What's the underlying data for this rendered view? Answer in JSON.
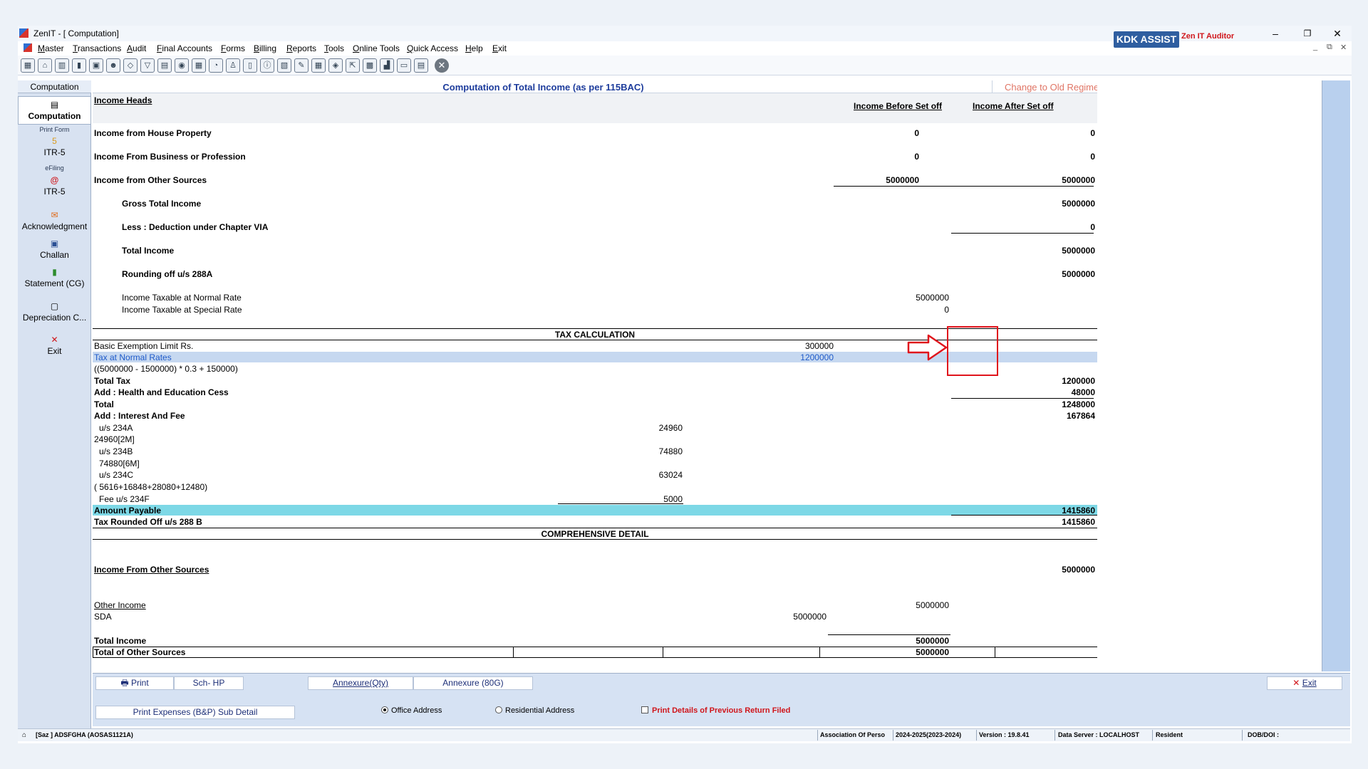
{
  "window": {
    "title": "ZenIT - [ Computation]",
    "controls": {
      "minimize": "–",
      "restore": "❐",
      "close": "✕"
    },
    "mdi_controls": {
      "minimize": "_",
      "restore": "⧉",
      "close": "✕"
    }
  },
  "menu": [
    "Master",
    "Transactions",
    "Audit",
    "Final Accounts",
    "Forms",
    "Billing",
    "Reports",
    "Tools",
    "Online Tools",
    "Quick Access",
    "Help",
    "Exit"
  ],
  "toolbar": {
    "kdk_assist": "KDK ASSIST",
    "zen_it_auditor": "Zen IT Auditor"
  },
  "sidebar": {
    "header": "Computation",
    "computation": "Computation",
    "print_form_caption": "Print Form",
    "itr5_print": "ITR-5",
    "efiling_caption": "eFiling",
    "itr5_efile": "ITR-5",
    "acknowledgment": "Acknowledgment",
    "challan": "Challan",
    "statement_cg": "Statement (CG)",
    "depreciation": "Depreciation C...",
    "exit": "Exit"
  },
  "computation": {
    "title": "Computation of Total Income (as per 115BAC)",
    "change_regime": "Change to Old Regime Tax",
    "income_heads": "Income Heads",
    "col_before": "Income Before Set off",
    "col_after": "Income After Set off",
    "rows": {
      "house_property": {
        "label": "Income from House Property",
        "before": "0",
        "after": "0"
      },
      "business": {
        "label": "Income From Business or Profession",
        "before": "0",
        "after": "0"
      },
      "other_sources": {
        "label": "Income from Other Sources",
        "before": "5000000",
        "after": "5000000"
      },
      "gross_total": {
        "label": "Gross Total Income",
        "after": "5000000"
      },
      "deduction_via": {
        "label": "Less : Deduction under Chapter VIA",
        "after": "0"
      },
      "total_income": {
        "label": "Total Income",
        "after": "5000000"
      },
      "rounding": {
        "label": "Rounding off u/s 288A",
        "after": "5000000"
      },
      "taxable_normal": {
        "label": "Income Taxable at Normal Rate",
        "value": "5000000"
      },
      "taxable_special": {
        "label": "Income Taxable at Special Rate",
        "value": "0"
      }
    },
    "tax_calc": {
      "heading": "TAX CALCULATION",
      "basic_exemption": {
        "label": "Basic Exemption Limit Rs.",
        "value": "300000"
      },
      "tax_normal": {
        "label": "Tax at Normal Rates",
        "value": "1200000"
      },
      "formula": "((5000000 - 1500000) * 0.3 + 150000)",
      "total_tax": {
        "label": "Total Tax",
        "value": "1200000"
      },
      "cess": {
        "label": "Add : Health and Education Cess",
        "value": "48000"
      },
      "total": {
        "label": "Total",
        "value": "1248000"
      },
      "interest_fee": {
        "label": "Add : Interest And Fee",
        "value": "167864"
      },
      "s234a": {
        "label": "u/s 234A",
        "value": "24960",
        "note": "24960[2M]"
      },
      "s234b": {
        "label": "u/s 234B",
        "value": "74880",
        "note": "74880[6M]"
      },
      "s234c": {
        "label": "u/s 234C",
        "value": "63024",
        "note": "(  5616+16848+28080+12480)"
      },
      "fee234f": {
        "label": "Fee u/s 234F",
        "value": "5000"
      },
      "amount_payable": {
        "label": "Amount Payable",
        "value": "1415860"
      },
      "tax_rounded": {
        "label": "Tax Rounded Off u/s 288 B",
        "value": "1415860"
      }
    },
    "comprehensive": {
      "heading": "COMPREHENSIVE DETAIL",
      "ios_label": "Income From Other Sources",
      "ios_value": "5000000",
      "other_income_label": "Other Income",
      "other_income_value": "5000000",
      "sda_label": "SDA",
      "sda_value": "5000000",
      "total_income_label": "Total Income",
      "total_income_value": "5000000",
      "total_other_label": "Total of Other Sources",
      "total_other_value": "5000000"
    }
  },
  "bottom": {
    "print": "Print",
    "sch_hp": "Sch- HP",
    "annexure_qty": "Annexure(Qty)",
    "annexure_80g": "Annexure (80G)",
    "exit": "Exit",
    "print_expenses": "Print Expenses (B&P) Sub Detail",
    "office_address": "Office Address",
    "residential_address": "Residential Address",
    "print_prev_return": "Print Details of Previous Return Filed"
  },
  "status": {
    "client": "[Saz ] ADSFGHA (AOSAS1121A)",
    "status_type": "Association Of Perso",
    "assessment_year": "2024-2025(2023-2024)",
    "version": "Version : 19.8.41",
    "data_server": "Data Server : LOCALHOST",
    "residency": "Resident",
    "dob": "DOB/DOI :"
  },
  "colors": {
    "highlight_row": "#c6d8f0",
    "amount_payable_row": "#7dd8e6",
    "annotation": "#e0141c",
    "accent_blue": "#1d3c9c",
    "regime_link": "#e07565"
  }
}
